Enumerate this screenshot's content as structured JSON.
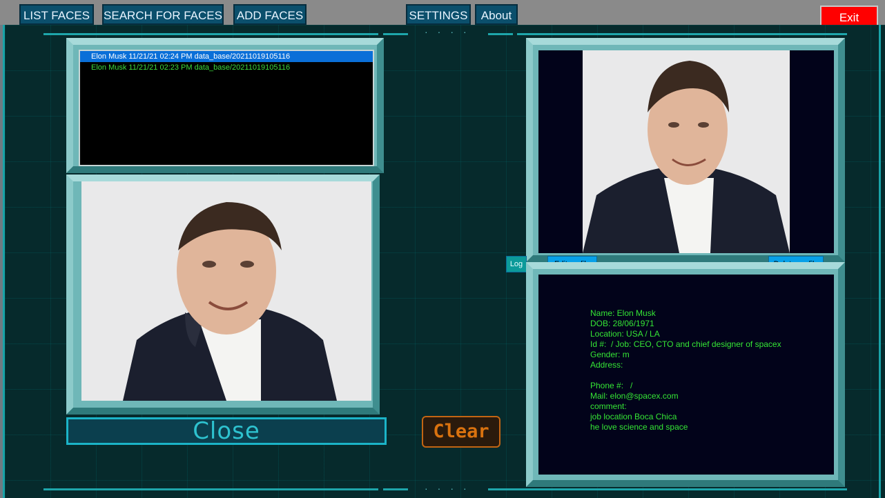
{
  "menu": {
    "list_faces": "LIST FACES",
    "search_for_faces": "SEARCH FOR FACES",
    "add_faces": "ADD FACES",
    "settings": "SETTINGS",
    "about": "About",
    "exit": "Exit"
  },
  "results": [
    {
      "text": "Elon Musk 11/21/21 02:24 PM data_base/20211019105116",
      "selected": true
    },
    {
      "text": "Elon Musk 11/21/21 02:23 PM data_base/20211019105116",
      "selected": false
    }
  ],
  "profile_buttons": {
    "log": "Log",
    "edit": "Edit profile",
    "delete": "Delete profile"
  },
  "profile_info": {
    "name": "Name: Elon Musk",
    "dob": "DOB: 28/06/1971",
    "location": "Location: USA / LA",
    "id_job": "Id #:  / Job: CEO, CTO and chief designer of spacex",
    "gender": "Gender: m",
    "address": "Address:",
    "blank": "",
    "phone": "Phone #:   /",
    "mail": "Mail: elon@spacex.com",
    "comment": "comment:",
    "comment_line1": "job location Boca Chica",
    "comment_line2": "he love science and space"
  },
  "actions": {
    "close": "Close",
    "clear": "Clear"
  },
  "colors": {
    "accent": "#1ea6ab",
    "info_text": "#35e635",
    "exit": "#ff0000",
    "clear": "#d9720f"
  }
}
